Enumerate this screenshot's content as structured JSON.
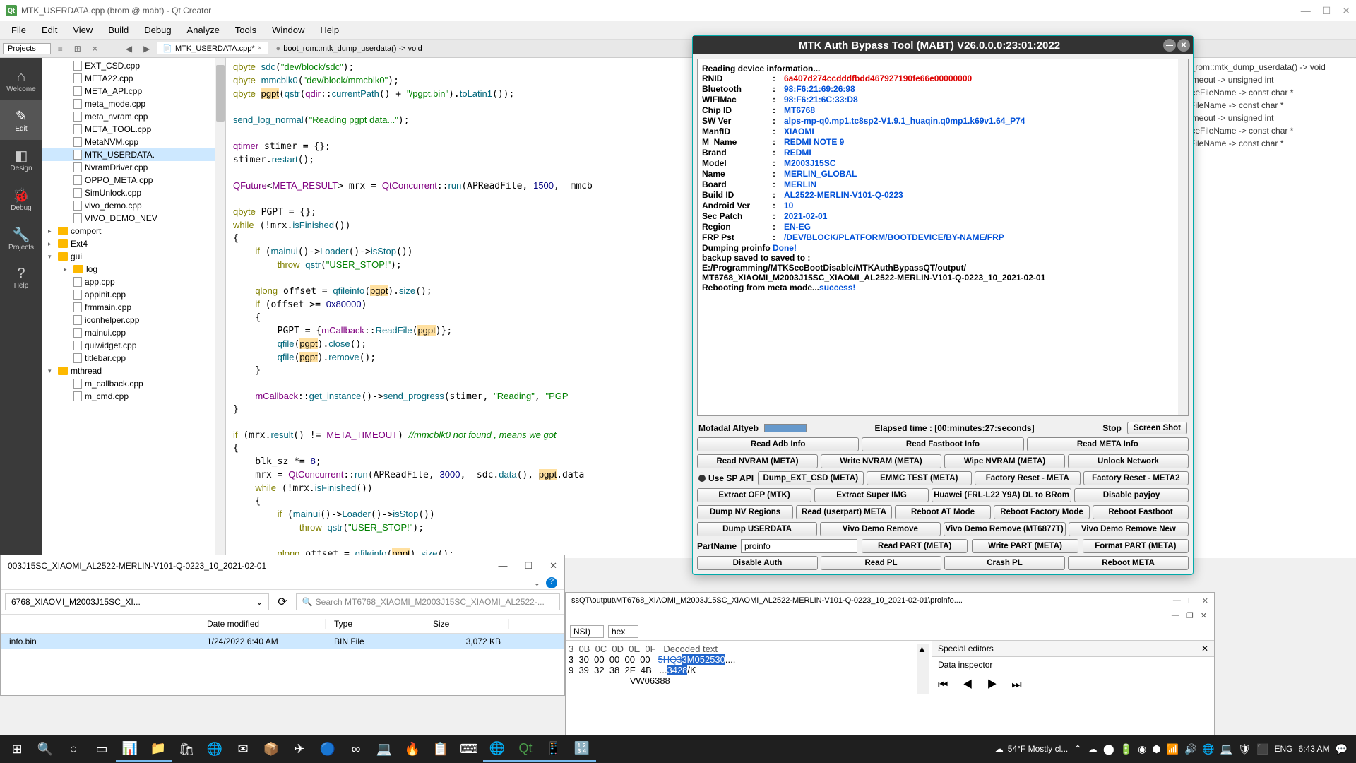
{
  "qt": {
    "title": "MTK_USERDATA.cpp (brom @ mabt) - Qt Creator",
    "menu": [
      "File",
      "Edit",
      "View",
      "Build",
      "Debug",
      "Analyze",
      "Tools",
      "Window",
      "Help"
    ],
    "dropdown": "Projects",
    "tabs": [
      {
        "name": "MTK_USERDATA.cpp*",
        "active": true
      },
      {
        "name": "boot_rom::mtk_dump_userdata() -> void",
        "active": false
      }
    ],
    "sidebar": [
      {
        "label": "Welcome"
      },
      {
        "label": "Edit",
        "active": true
      },
      {
        "label": "Design"
      },
      {
        "label": "Debug"
      },
      {
        "label": "Projects"
      },
      {
        "label": "Help"
      }
    ],
    "files": [
      {
        "name": "EXT_CSD.cpp",
        "indent": 1,
        "icon": "cpp"
      },
      {
        "name": "META22.cpp",
        "indent": 1,
        "icon": "cpp"
      },
      {
        "name": "META_API.cpp",
        "indent": 1,
        "icon": "cpp"
      },
      {
        "name": "meta_mode.cpp",
        "indent": 1,
        "icon": "cpp"
      },
      {
        "name": "meta_nvram.cpp",
        "indent": 1,
        "icon": "cpp"
      },
      {
        "name": "META_TOOL.cpp",
        "indent": 1,
        "icon": "cpp"
      },
      {
        "name": "MetaNVM.cpp",
        "indent": 1,
        "icon": "cpp"
      },
      {
        "name": "MTK_USERDATA.",
        "indent": 1,
        "icon": "cpp",
        "selected": true
      },
      {
        "name": "NvramDriver.cpp",
        "indent": 1,
        "icon": "cpp"
      },
      {
        "name": "OPPO_META.cpp",
        "indent": 1,
        "icon": "cpp"
      },
      {
        "name": "SimUnlock.cpp",
        "indent": 1,
        "icon": "cpp"
      },
      {
        "name": "vivo_demo.cpp",
        "indent": 1,
        "icon": "cpp"
      },
      {
        "name": "VIVO_DEMO_NEV",
        "indent": 1,
        "icon": "cpp"
      },
      {
        "name": "comport",
        "indent": 0,
        "icon": "folder",
        "chev": "▸"
      },
      {
        "name": "Ext4",
        "indent": 0,
        "icon": "folder",
        "chev": "▸"
      },
      {
        "name": "gui",
        "indent": 0,
        "icon": "folder",
        "chev": "▾"
      },
      {
        "name": "log",
        "indent": 1,
        "icon": "folder",
        "chev": "▸"
      },
      {
        "name": "app.cpp",
        "indent": 1,
        "icon": "cpp"
      },
      {
        "name": "appinit.cpp",
        "indent": 1,
        "icon": "cpp"
      },
      {
        "name": "frmmain.cpp",
        "indent": 1,
        "icon": "cpp"
      },
      {
        "name": "iconhelper.cpp",
        "indent": 1,
        "icon": "cpp"
      },
      {
        "name": "mainui.cpp",
        "indent": 1,
        "icon": "cpp"
      },
      {
        "name": "quiwidget.cpp",
        "indent": 1,
        "icon": "cpp"
      },
      {
        "name": "titlebar.cpp",
        "indent": 1,
        "icon": "cpp"
      },
      {
        "name": "mthread",
        "indent": 0,
        "icon": "folder",
        "chev": "▾"
      },
      {
        "name": "m_callback.cpp",
        "indent": 1,
        "icon": "cpp"
      },
      {
        "name": "m_cmd.cpp",
        "indent": 1,
        "icon": "cpp"
      }
    ],
    "symbols": [
      "bot_rom::mtk_dump_userdata() -> void",
      "s_timeout -> unsigned int",
      "ourceFileName -> const char *",
      "estFileName -> const char *",
      "s_timeout -> unsigned int",
      "ourceFileName -> const char *",
      "estFileName -> const char *"
    ]
  },
  "mabt": {
    "title": "MTK Auth Bypass Tool (MABT) V26.0.0.0:23:01:2022",
    "log_header": "Reading device information...",
    "info": [
      {
        "k": "RNID",
        "v": "6a407d274ccdddfbdd467927190fe66e00000000",
        "red": true
      },
      {
        "k": "Bluetooth",
        "v": "98:F6:21:69:26:98"
      },
      {
        "k": "WIFIMac",
        "v": "98:F6:21:6C:33:D8"
      },
      {
        "k": "Chip ID",
        "v": "MT6768"
      },
      {
        "k": "SW Ver",
        "v": "alps-mp-q0.mp1.tc8sp2-V1.9.1_huaqin.q0mp1.k69v1.64_P74"
      },
      {
        "k": "ManfID",
        "v": "XIAOMI"
      },
      {
        "k": "M_Name",
        "v": "REDMI NOTE 9"
      },
      {
        "k": "Brand",
        "v": "REDMI"
      },
      {
        "k": "Model",
        "v": "M2003J15SC"
      },
      {
        "k": "Name",
        "v": "MERLIN_GLOBAL"
      },
      {
        "k": "Board",
        "v": "MERLIN"
      },
      {
        "k": "Build ID",
        "v": "AL2522-MERLIN-V101-Q-0223"
      },
      {
        "k": "Android Ver",
        "v": "10"
      },
      {
        "k": "Sec Patch",
        "v": "2021-02-01"
      },
      {
        "k": "Region",
        "v": "EN-EG"
      },
      {
        "k": "FRP Pst",
        "v": "/DEV/BLOCK/PLATFORM/BOOTDEVICE/BY-NAME/FRP"
      }
    ],
    "log_lines": [
      {
        "text": "Dumping proinfo ",
        "suffix": "Done!"
      },
      {
        "text": "backup saved to saved to :"
      },
      {
        "text": "E:/Programming/MTKSecBootDisable/MTKAuthBypassQT/output/"
      },
      {
        "text": "MT6768_XIAOMI_M2003J15SC_XIAOMI_AL2522-MERLIN-V101-Q-0223_10_2021-02-01"
      },
      {
        "text": "Rebooting from meta mode...",
        "suffix": "success!"
      }
    ],
    "status_name": "Mofadal Altyeb",
    "elapsed": "Elapsed time : [00:minutes:27:seconds]",
    "stop": "Stop",
    "screenshot": "Screen Shot",
    "rows": [
      [
        "Read Adb Info",
        "Read Fastboot Info",
        "Read META Info"
      ],
      [
        "Read NVRAM (META)",
        "Write NVRAM (META)",
        "Wipe NVRAM (META)",
        "Unlock Network"
      ],
      [
        "Dump_EXT_CSD (META)",
        "EMMC TEST (META)",
        "Factory Reset - META",
        "Factory Reset - META2"
      ],
      [
        "Extract OFP (MTK)",
        "Extract Super IMG",
        "Huawei (FRL-L22 Y9A) DL to BRom",
        "Disable payjoy"
      ],
      [
        "Dump NV Regions",
        "Read (userpart) META",
        "Reboot AT Mode",
        "Reboot Factory Mode",
        "Reboot Fastboot"
      ],
      [
        "Dump USERDATA",
        "Vivo Demo Remove",
        "Vivo Demo Remove (MT6877T)",
        "Vivo Demo Remove New"
      ],
      [
        "Read PART (META)",
        "Write PART (META)",
        "Format PART (META)"
      ],
      [
        "Disable Auth",
        "Read PL",
        "Crash PL",
        "Reboot META"
      ]
    ],
    "radio": "Use SP API",
    "partname_label": "PartName",
    "partname_value": "proinfo"
  },
  "explorer": {
    "title": "003J15SC_XIAOMI_AL2522-MERLIN-V101-Q-0223_10_2021-02-01",
    "path": "6768_XIAOMI_M2003J15SC_XI...",
    "search": "Search MT6768_XIAOMI_M2003J15SC_XIAOMI_AL2522-...",
    "cols": [
      "Date modified",
      "Type",
      "Size"
    ],
    "row": {
      "name": "info.bin",
      "date": "1/24/2022 6:40 AM",
      "type": "BIN File",
      "size": "3,072 KB"
    }
  },
  "hex": {
    "title": "ssQT\\output\\MT6768_XIAOMI_M2003J15SC_XIAOMI_AL2522-MERLIN-V101-Q-0223_10_2021-02-01\\proinfo....",
    "enc": "NSI)",
    "fmt": "hex",
    "editors": "Special editors",
    "inspector": "Data inspector",
    "header": "3  0B  0C  0D  0E  0F   Decoded text",
    "bytes1": "3  30  00  00  00  00   ",
    "decoded1_a": "5HQ3",
    "decoded1_b": "3M052530",
    "decoded1_c": "....",
    "bytes2": "9  39  32  38  2F  4B   ",
    "decoded2_a": "...",
    "decoded2_b": "3428",
    "decoded2_c": "/K",
    "bytes3": "                        ",
    "decoded3": "VW06388"
  },
  "taskbar": {
    "weather": "54°F Mostly cl...",
    "lang": "ENG",
    "time": "6:43 AM"
  }
}
